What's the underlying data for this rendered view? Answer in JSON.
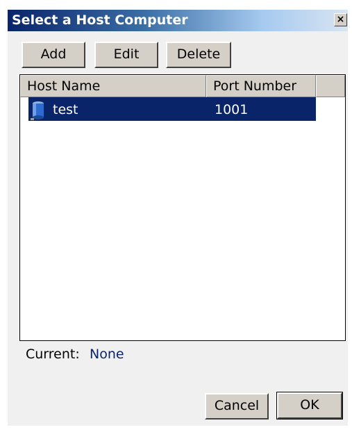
{
  "dialog": {
    "title": "Select a Host Computer",
    "close_glyph": "×",
    "close_icon": "close-icon"
  },
  "toolbar": {
    "add_label": "Add",
    "edit_label": "Edit",
    "delete_label": "Delete"
  },
  "list": {
    "columns": [
      "Host Name",
      "Port Number"
    ],
    "rows": [
      {
        "host": "test",
        "port": "1001",
        "selected": true,
        "icon": "host-computer-icon"
      }
    ]
  },
  "status": {
    "current_label": "Current:",
    "current_value": "None"
  },
  "footer": {
    "cancel_label": "Cancel",
    "ok_label": "OK"
  },
  "colors": {
    "title_bar": "#0a246a",
    "selection": "#0a246a",
    "current_value": "#0a246a",
    "button_face": "#d4d0c8"
  }
}
